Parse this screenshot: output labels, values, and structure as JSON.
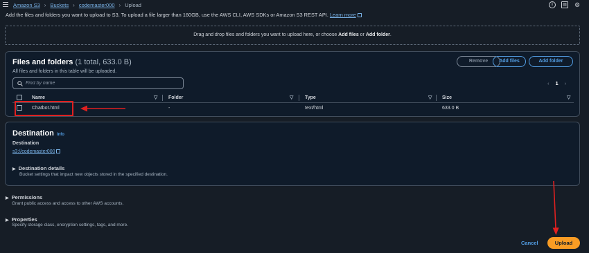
{
  "breadcrumb": {
    "items": [
      "Amazon S3",
      "Buckets",
      "codemaster000"
    ],
    "current": "Upload"
  },
  "top_icons": [
    "info-icon",
    "split-panel-icon",
    "settings-icon"
  ],
  "intro": {
    "text": "Add the files and folders you want to upload to S3. To upload a file larger than 160GB, use the AWS CLI, AWS SDKs or Amazon S3 REST API.",
    "link": "Learn more"
  },
  "dropzone": {
    "prefix": "Drag and drop files and folders you want to upload here, or choose ",
    "add_files": "Add files",
    "or": " or ",
    "add_folder": "Add folder",
    "suffix": "."
  },
  "files_panel": {
    "title": "Files and folders",
    "count": "(1 total, 633.0 B)",
    "subtitle": "All files and folders in this table will be uploaded.",
    "remove_label": "Remove",
    "add_files_label": "Add files",
    "add_folder_label": "Add folder",
    "search_placeholder": "Find by name",
    "page": "1",
    "columns": [
      "Name",
      "Folder",
      "Type",
      "Size"
    ],
    "rows": [
      {
        "name": "Chatbot.html",
        "folder": "-",
        "type": "text/html",
        "size": "633.0 B"
      }
    ]
  },
  "destination": {
    "title": "Destination",
    "info": "Info",
    "label": "Destination",
    "link": "s3://codemaster000",
    "details_title": "Destination details",
    "details_sub": "Bucket settings that impact new objects stored in the specified destination."
  },
  "permissions": {
    "title": "Permissions",
    "sub": "Grant public access and access to other AWS accounts."
  },
  "properties": {
    "title": "Properties",
    "sub": "Specify storage class, encryption settings, tags, and more."
  },
  "footer": {
    "cancel_label": "Cancel",
    "upload_label": "Upload"
  },
  "colors": {
    "background": "#161d26",
    "link": "#539fe5",
    "primary_button": "#f89c24",
    "annotation": "#e02020"
  }
}
